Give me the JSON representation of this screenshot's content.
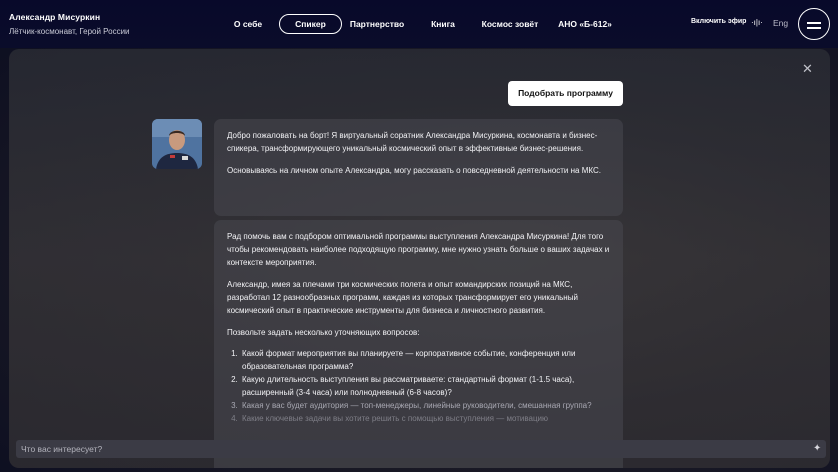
{
  "header": {
    "name": "Александр Мисуркин",
    "subtitle": "Лётчик-космонавт, Герой России",
    "nav": [
      {
        "label": "О себе"
      },
      {
        "label": "Спикер"
      },
      {
        "label": "Партнерство"
      },
      {
        "label": "Книга"
      },
      {
        "label": "Космос зовёт"
      },
      {
        "label": "АНО «Б-612»"
      }
    ],
    "live_label": "Включить эфир",
    "live_icon": "·ı|ı·",
    "lang": "Eng"
  },
  "chat": {
    "close_icon": "✕",
    "pick_button": "Подобрать программу",
    "message1": {
      "p1": "Добро пожаловать на борт! Я виртуальный соратник Александра Мисуркина, космонавта и бизнес-спикера, трансформирующего уникальный космический опыт в эффективные бизнес-решения.",
      "p2": "Основываясь на личном опыте Александра, могу рассказать о повседневной деятельности на МКС."
    },
    "message2": {
      "p1": "Рад помочь вам с подбором оптимальной программы выступления Александра Мисуркина! Для того чтобы рекомендовать наиболее подходящую программу, мне нужно узнать больше о ваших задачах и контексте мероприятия.",
      "p2": "Александр, имея за плечами три космических полета и опыт командирских позиций на МКС, разработал 12 разнообразных программ, каждая из которых трансформирует его уникальный космический опыт в практические инструменты для бизнеса и личностного развития.",
      "p3": "Позвольте задать несколько уточняющих вопросов:",
      "questions": [
        "Какой формат мероприятия вы планируете — корпоративное событие, конференция или образовательная программа?",
        "Какую длительность выступления вы рассматриваете: стандартный формат (1-1.5 часа), расширенный (3-4 часа) или полнодневный (6-8 часов)?",
        "Какая у вас будет аудитория — топ-менеджеры, линейные руководители, смешанная группа?",
        "Какие ключевые задачи вы хотите решить с помощью выступления — мотивацию"
      ]
    },
    "input_placeholder": "Что вас интересует?",
    "send_icon": "✦"
  }
}
